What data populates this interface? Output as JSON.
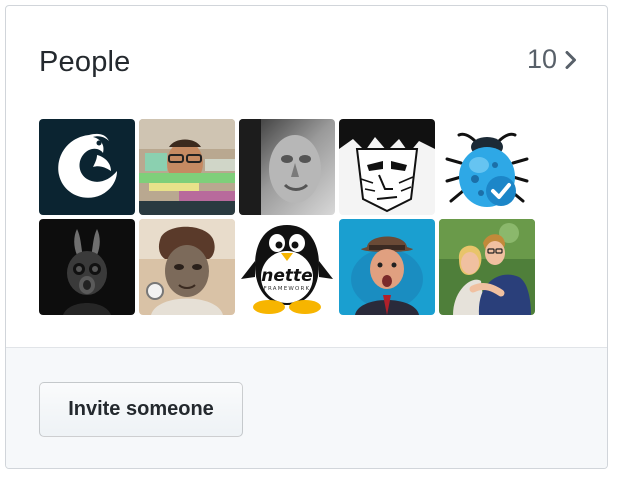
{
  "card": {
    "title": "People",
    "count": "10"
  },
  "avatars": [
    {
      "name": "avatar-1",
      "style": "phoenix-logo",
      "bg": "#0b2431"
    },
    {
      "name": "avatar-2",
      "style": "glitch-photo",
      "bg": "#b9a890"
    },
    {
      "name": "avatar-3",
      "style": "stone-face",
      "bg": "#8a8a8a"
    },
    {
      "name": "avatar-4",
      "style": "manga-face",
      "bg": "#ffffff"
    },
    {
      "name": "avatar-5",
      "style": "blue-bug",
      "bg": "#ffffff"
    },
    {
      "name": "avatar-6",
      "style": "gas-mask-bunny",
      "bg": "#111111"
    },
    {
      "name": "avatar-7",
      "style": "selfie-photo",
      "bg": "#8c7866"
    },
    {
      "name": "avatar-8",
      "style": "nette-penguin",
      "bg": "#ffffff"
    },
    {
      "name": "avatar-9",
      "style": "hat-man-photo",
      "bg": "#1a9fd0"
    },
    {
      "name": "avatar-10",
      "style": "couple-photo",
      "bg": "#4f7f3a"
    }
  ],
  "avatar_text": {
    "nette_logo": "nette",
    "nette_sub": "FRAMEWORK"
  },
  "footer": {
    "invite_label": "Invite someone"
  }
}
